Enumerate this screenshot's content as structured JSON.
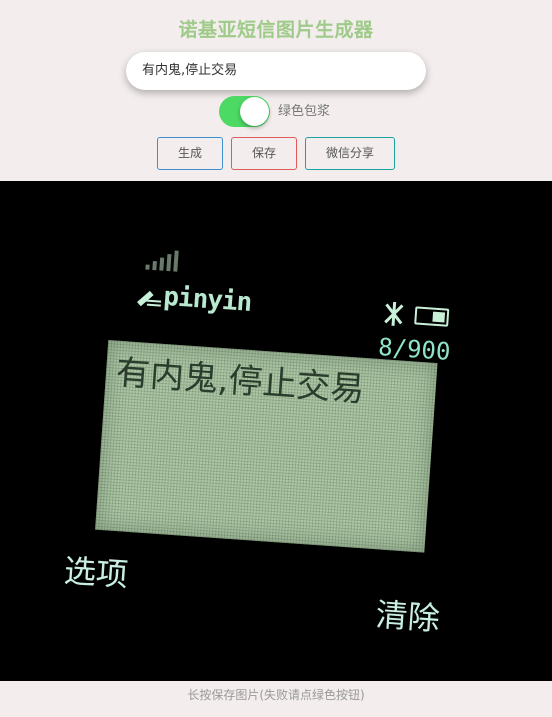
{
  "app": {
    "title": "诺基亚短信图片生成器"
  },
  "input": {
    "value": "有内鬼,停止交易",
    "placeholder": ""
  },
  "toggle": {
    "label": "绿色包浆",
    "on": true,
    "color": "#4cd964"
  },
  "buttons": {
    "generate": "生成",
    "save": "保存",
    "share": "微信分享"
  },
  "phone": {
    "mode": "pinyin",
    "counter": "8/900",
    "message": "有内鬼,停止交易",
    "softkey_left": "选项",
    "softkey_right": "清除"
  },
  "footer": {
    "hint": "长按保存图片(失败请点绿色按钮)"
  },
  "colors": {
    "title": "#9fcb8a",
    "accent_green": "#4cd964",
    "screen_bg": "#aec8a6"
  }
}
